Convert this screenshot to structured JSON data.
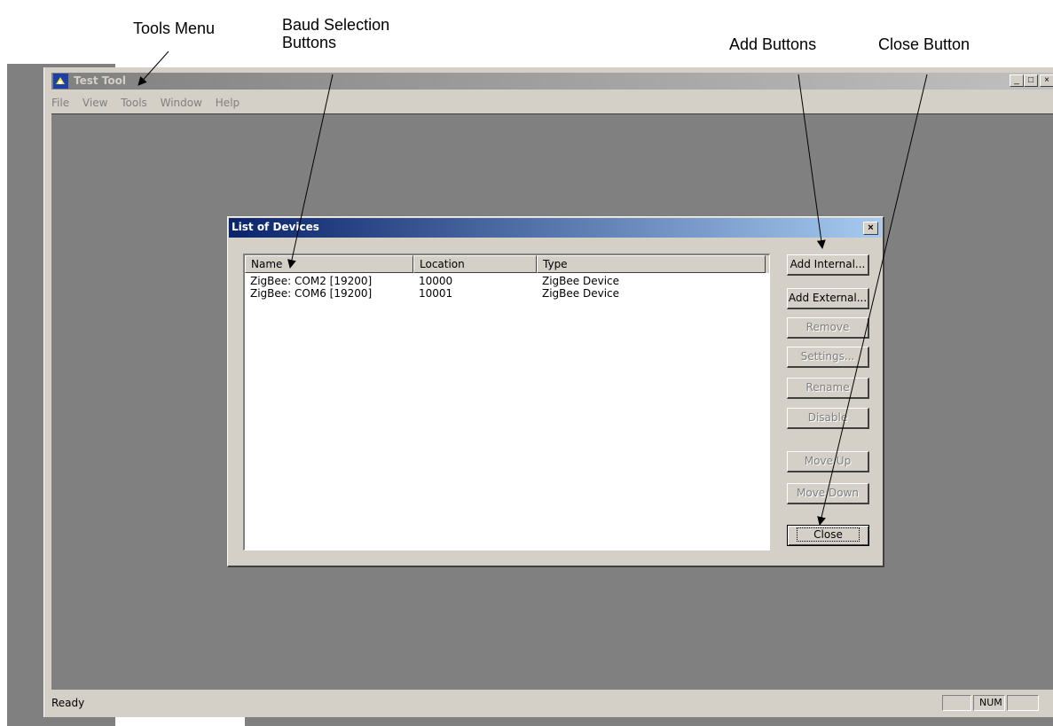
{
  "annotations": {
    "tools_menu": "Tools Menu",
    "baud_selection": "Baud Selection\nButtons",
    "add_buttons": "Add Buttons",
    "close_button": "Close Button"
  },
  "app": {
    "title": "Test Tool",
    "menu": [
      "File",
      "View",
      "Tools",
      "Window",
      "Help"
    ],
    "window_controls": {
      "minimize": "_",
      "maximize": "□",
      "close": "×"
    },
    "status": {
      "text": "Ready",
      "panes": [
        "",
        "NUM",
        ""
      ]
    }
  },
  "dialog": {
    "title": "List of Devices",
    "close": "×",
    "columns": [
      "Name",
      "Location",
      "Type"
    ],
    "rows": [
      {
        "name": "ZigBee: COM2 [19200]",
        "location": "10000",
        "type": "ZigBee Device"
      },
      {
        "name": "ZigBee: COM6 [19200]",
        "location": "10001",
        "type": "ZigBee Device"
      }
    ],
    "buttons": {
      "add_internal": "Add Internal...",
      "add_external": "Add External...",
      "remove": "Remove",
      "settings": "Settings...",
      "rename": "Rename",
      "disable": "Disable",
      "move_up": "Move Up",
      "move_down": "Move Down",
      "close": "Close"
    }
  },
  "colors": {
    "title_active_start": "#0a246a",
    "title_active_end": "#a6caf0",
    "title_inactive_start": "#808080",
    "face": "#d4d0c8",
    "workspace": "#808080"
  }
}
